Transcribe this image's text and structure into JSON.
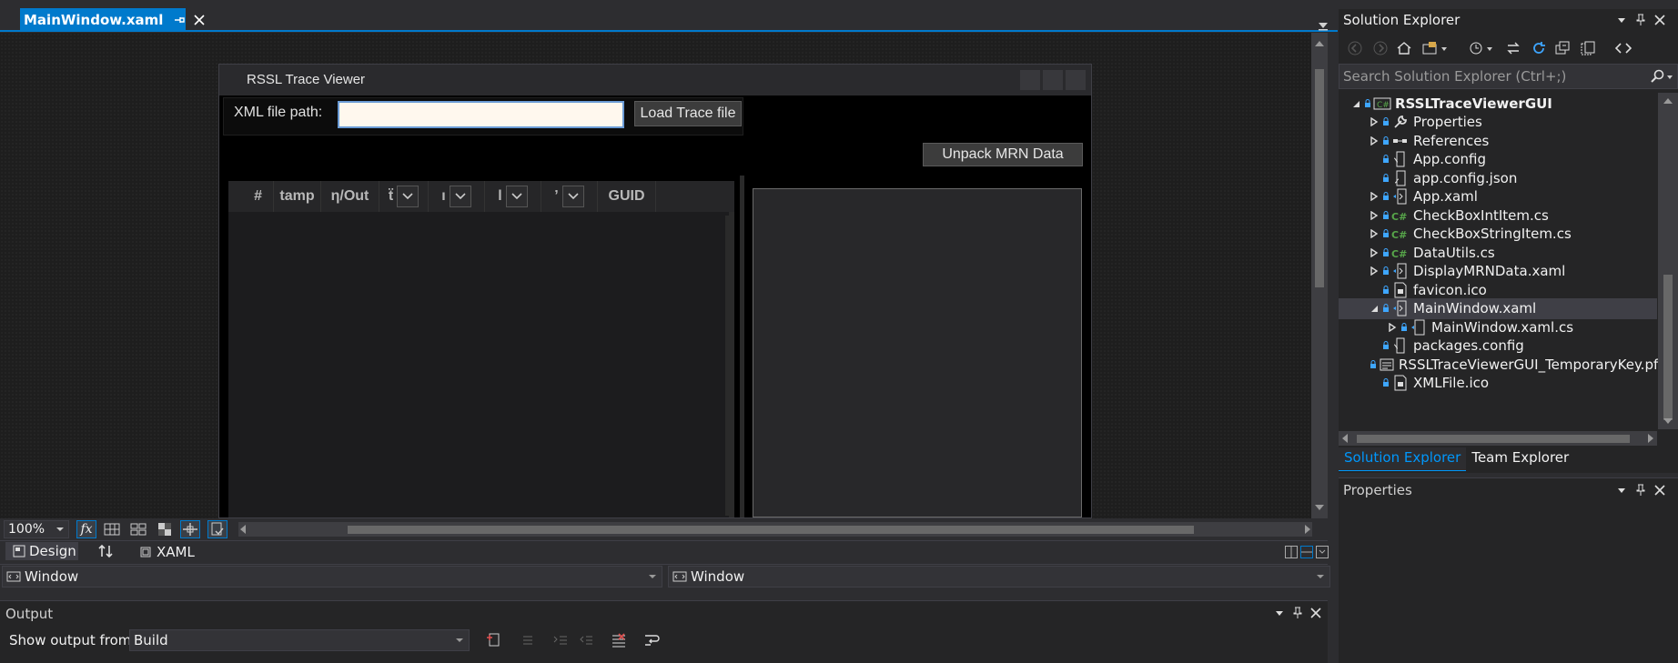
{
  "document_tabs": [
    {
      "label": "MainWindow.xaml",
      "active": true
    }
  ],
  "mock_window": {
    "title": "RSSL Trace Viewer",
    "path_label": "XML file path:",
    "path_value": "",
    "load_button": "Load Trace file",
    "unpack_button": "Unpack MRN Data",
    "grid_columns": [
      "#",
      "tamp",
      "η/Out",
      "ẗ",
      "ı",
      "l",
      "’",
      "GUID"
    ]
  },
  "zoom": {
    "value": "100%",
    "fx_label": "fx"
  },
  "mode_tabs": {
    "design": "Design",
    "xaml": "XAML"
  },
  "selectors": {
    "left": "Window",
    "right": "Window"
  },
  "output": {
    "title": "Output",
    "show_from_label": "Show output from:",
    "source": "Build"
  },
  "solution_explorer": {
    "title": "Solution Explorer",
    "search_placeholder": "Search Solution Explorer (Ctrl+;)",
    "tree": [
      {
        "label": "RSSLTraceViewerGUI",
        "level": 0,
        "expander": "expanded",
        "icon": "csproj-icon",
        "bold": true
      },
      {
        "label": "Properties",
        "level": 1,
        "expander": "collapsed",
        "icon": "wrench-icon"
      },
      {
        "label": "References",
        "level": 1,
        "expander": "collapsed",
        "icon": "references-icon"
      },
      {
        "label": "App.config",
        "level": 1,
        "expander": "none",
        "icon": "config-icon"
      },
      {
        "label": "app.config.json",
        "level": 1,
        "expander": "none",
        "icon": "json-icon"
      },
      {
        "label": "App.xaml",
        "level": 1,
        "expander": "collapsed",
        "icon": "xaml-icon"
      },
      {
        "label": "CheckBoxIntItem.cs",
        "level": 1,
        "expander": "collapsed",
        "icon": "csharp-icon"
      },
      {
        "label": "CheckBoxStringItem.cs",
        "level": 1,
        "expander": "collapsed",
        "icon": "csharp-icon"
      },
      {
        "label": "DataUtils.cs",
        "level": 1,
        "expander": "collapsed",
        "icon": "csharp-icon"
      },
      {
        "label": "DisplayMRNData.xaml",
        "level": 1,
        "expander": "collapsed",
        "icon": "xaml-icon"
      },
      {
        "label": "favicon.ico",
        "level": 1,
        "expander": "none",
        "icon": "ico-file-icon"
      },
      {
        "label": "MainWindow.xaml",
        "level": 1,
        "expander": "expanded",
        "icon": "xaml-icon",
        "selected": true
      },
      {
        "label": "MainWindow.xaml.cs",
        "level": 2,
        "expander": "collapsed",
        "icon": "csharp-file-icon"
      },
      {
        "label": "packages.config",
        "level": 1,
        "expander": "none",
        "icon": "config-icon"
      },
      {
        "label": "RSSLTraceViewerGUI_TemporaryKey.pfx",
        "level": 1,
        "expander": "none",
        "icon": "pfx-icon"
      },
      {
        "label": "XMLFile.ico",
        "level": 1,
        "expander": "none",
        "icon": "ico-file-icon"
      }
    ],
    "bottom_tabs": [
      "Solution Explorer",
      "Team Explorer"
    ]
  },
  "properties": {
    "title": "Properties"
  },
  "colors": {
    "accent": "#007acc",
    "background": "#2d2d30",
    "panel": "#252526",
    "csharp": "#57a64a"
  }
}
